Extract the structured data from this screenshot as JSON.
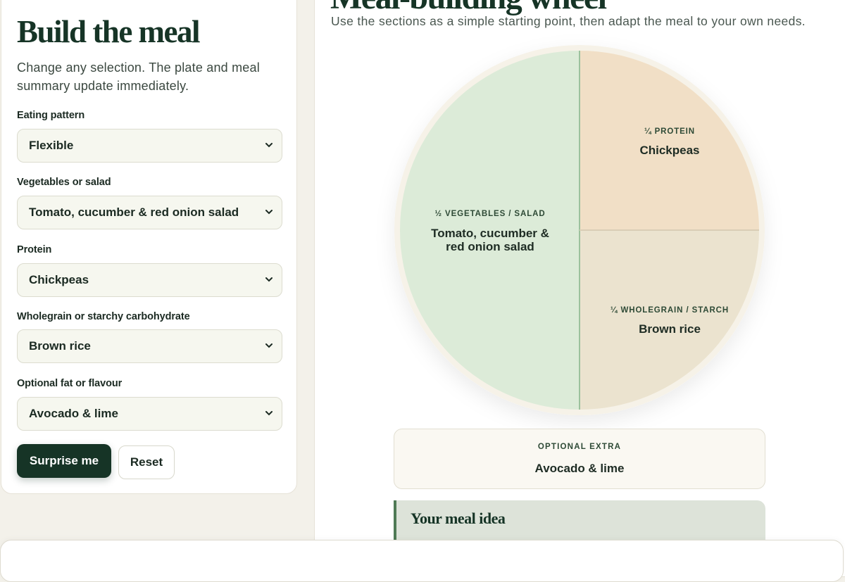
{
  "builder": {
    "title": "Build the meal",
    "intro": "Change any selection. The plate and meal summary update immediately.",
    "fields": [
      {
        "label": "Eating pattern",
        "value": "Flexible"
      },
      {
        "label": "Vegetables or salad",
        "value": "Tomato, cucumber & red onion salad"
      },
      {
        "label": "Protein",
        "value": "Chickpeas"
      },
      {
        "label": "Wholegrain or starchy carbohydrate",
        "value": "Brown rice"
      },
      {
        "label": "Optional fat or flavour",
        "value": "Avocado & lime"
      }
    ],
    "surprise_label": "Surprise me",
    "reset_label": "Reset"
  },
  "preview": {
    "title": "Meal-building wheel",
    "subtitle": "Use the sections as a simple starting point, then adapt the meal to your own needs.",
    "plate": {
      "vegetables": {
        "kicker": "½ VEGETABLES / SALAD",
        "name": "Tomato, cucumber & red onion salad",
        "share": 0.5,
        "color": "#dcebd8"
      },
      "protein": {
        "kicker": "¼ PROTEIN",
        "name": "Chickpeas",
        "share": 0.25,
        "color": "#f1dfc6"
      },
      "starch": {
        "kicker": "¼ WHOLEGRAIN / STARCH",
        "name": "Brown rice",
        "share": 0.25,
        "color": "#ebe3cf"
      }
    },
    "extra": {
      "kicker": "OPTIONAL EXTRA",
      "value": "Avocado & lime"
    },
    "meal_idea_title": "Your meal idea"
  },
  "colors": {
    "brand": "#163426",
    "accent": "#4f7a55",
    "page_bg": "#f3f1ea"
  }
}
